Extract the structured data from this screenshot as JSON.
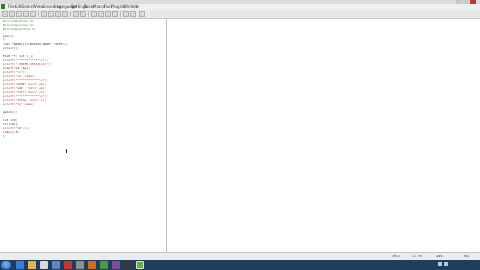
{
  "window": {
    "title": "",
    "accent": "#2f7d32"
  },
  "menubar": {
    "items": [
      "File",
      "Edit",
      "Search",
      "View",
      "Encoding",
      "Language",
      "Settings",
      "Tools",
      "Macro",
      "Run",
      "Plugins",
      "Window",
      "?"
    ]
  },
  "editor": {
    "code_lines": [
      "#include<stdio.h>",
      "#include<conio.h>",
      "#include<stdlib.h>",
      "",
      "main()",
      "{",
      "  char *BASE[]={\"BSSTUV_WIRE\",\"ACEC\"};",
      "  clrscr();",
      "",
      "  FILE *f; int i,j;",
      "  printf(\"************\\n\");",
      "  printf(\"  ENTER DETAILS\\n\");",
      "  scanf(\"%s\",&n);",
      "  printf(\"\\n\");",
      "  printf(\"%s\",name);",
      "  printf(\"************\\n\");",
      "  printf(\"NAME: %s\\n\",nm);",
      "  printf(\"AGE : %d\\n\",ag);",
      "  printf(\"CITY: %s\\n\",ct);",
      "  printf(\"************\\n\");",
      "  printf(\"TOTAL: %d\\n\",t);",
      "  printf(\"%s\",name);",
      "",
      "  getch();",
      "",
      "  int i=0;",
      "  if(i>0){",
      "  printf(\"%d\",i);",
      "  return 0;",
      "  }"
    ]
  },
  "statusbar": {
    "length": "2814",
    "lines": "Ln : 35",
    "encoding": "ANSI",
    "mode": "INS",
    "eol": "Windows (CR LF)"
  },
  "taskbar": {
    "time": "",
    "date": ""
  }
}
